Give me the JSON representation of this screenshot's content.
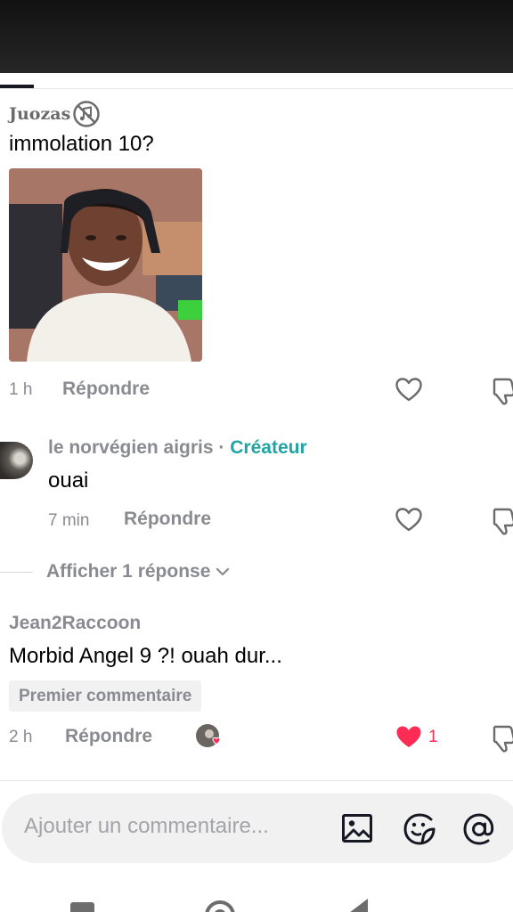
{
  "comments": [
    {
      "username": "Juozas",
      "text": "immolation 10?",
      "time": "1 h",
      "reply_label": "Répondre",
      "has_image": true
    },
    {
      "username": "le norvégien aigris",
      "separator": "·",
      "badge": "Créateur",
      "text": "ouai",
      "time": "7 min",
      "reply_label": "Répondre"
    },
    {
      "username": "Jean2Raccoon",
      "text": "Morbid Angel 9 ?! ouah dur...",
      "tag": "Premier commentaire",
      "time": "2 h",
      "reply_label": "Répondre",
      "like_count": "1",
      "liked": true
    }
  ],
  "view_replies_label": "Afficher 1 réponse",
  "comment_input": {
    "placeholder": "Ajouter un commentaire..."
  },
  "icons": {
    "like": "heart-outline-icon",
    "liked": "heart-filled-icon",
    "dislike": "thumbs-down-icon",
    "image": "image-icon",
    "emoji": "emoji-sticker-icon",
    "mention": "at-mention-icon"
  },
  "colors": {
    "accent_creator": "#20a4a4",
    "like_active": "#fe2c55",
    "meta_gray": "#8a8b91"
  }
}
